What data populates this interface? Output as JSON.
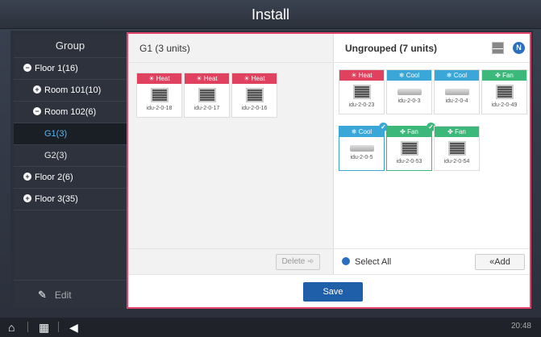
{
  "title": "Install",
  "sidebar": {
    "header": "Group",
    "items": [
      {
        "label": "Floor 1(16)",
        "bullet": "−"
      },
      {
        "label": "Room 101(10)",
        "bullet": "+"
      },
      {
        "label": "Room 102(6)",
        "bullet": "−"
      },
      {
        "label": "G1(3)"
      },
      {
        "label": "G2(3)"
      },
      {
        "label": "Floor 2(6)",
        "bullet": "+"
      },
      {
        "label": "Floor 3(35)",
        "bullet": "+"
      }
    ],
    "edit_label": "Edit"
  },
  "left_pane": {
    "title": "G1 (3 units)",
    "units": [
      {
        "mode": "Heat",
        "name": "idu-2-0-18"
      },
      {
        "mode": "Heat",
        "name": "idu-2-0-17"
      },
      {
        "mode": "Heat",
        "name": "idu-2-0-16"
      }
    ],
    "delete_label": "Delete"
  },
  "right_pane": {
    "title": "Ungrouped (7 units)",
    "n_badge": "N",
    "units": [
      {
        "mode": "Heat",
        "name": "idu-2-0-23"
      },
      {
        "mode": "Cool",
        "name": "idu-2-0-3"
      },
      {
        "mode": "Cool",
        "name": "idu-2-0-4"
      },
      {
        "mode": "Fan",
        "name": "idu-2-0-49"
      },
      {
        "mode": "Cool",
        "name": "idu-2-0-5"
      },
      {
        "mode": "Fan",
        "name": "idu-2-0-53"
      },
      {
        "mode": "Fan",
        "name": "idu-2-0-54"
      }
    ],
    "select_all_label": "Select All",
    "add_label": "Add"
  },
  "save_label": "Save",
  "time": "20:48"
}
